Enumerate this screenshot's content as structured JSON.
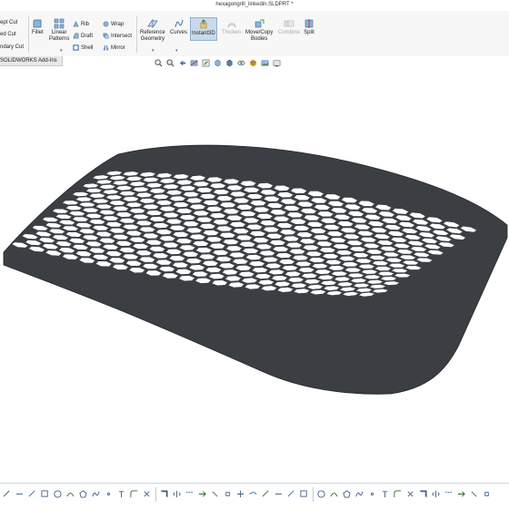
{
  "window": {
    "title": "hexagongrill_linkedin.SLDPRT *"
  },
  "ribbon": {
    "left_items": [
      "ept Cut",
      "ed Cut",
      "ndary Cut"
    ],
    "fillet_label": "Fillet",
    "linear_patterns_label": "Linear\nPatterns",
    "rib_label": "Rib",
    "draft_label": "Draft",
    "shell_label": "Shell",
    "wrap_label": "Wrap",
    "intersect_label": "Intersect",
    "mirror_label": "Mirror",
    "reference_geometry_label": "Reference\nGeometry",
    "curves_label": "Curves",
    "instant3d_label": "Instant3D",
    "thicken_label": "Thicken",
    "move_copy_label": "Move/Copy\nBodies",
    "combine_label": "Combine",
    "split_label": "Split"
  },
  "tabs": {
    "addins_label": "SOLIDWORKS Add-Ins"
  },
  "view_toolbar": {
    "icons": [
      "zoom-to-fit-icon",
      "zoom-area-icon",
      "previous-view-icon",
      "section-view-icon",
      "dynamic-annotation-icon",
      "view-orientation-icon",
      "display-style-icon",
      "hide-show-icon",
      "edit-appearance-icon",
      "apply-scene-icon",
      "view-settings-icon"
    ]
  },
  "bottom_toolbar": {
    "icons": [
      "sketch-icon",
      "smart-dimension-icon",
      "line-icon",
      "rectangle-icon",
      "circle-icon",
      "arc-icon",
      "polygon-icon",
      "spline-icon",
      "point-icon",
      "text-icon",
      "fillet-sketch-icon",
      "trim-icon",
      "offset-icon",
      "mirror-entities-icon",
      "linear-pattern-icon",
      "move-entities-icon",
      "relations-icon",
      "repair-sketch-icon",
      "quick-snaps-icon",
      "rapid-sketch-icon",
      "circle2-icon",
      "slot-icon",
      "ellipse-icon",
      "parabola-icon",
      "construction-line-icon",
      "centerline-icon",
      "tangent-arc-icon",
      "sketch-fillet-icon",
      "chamfer-icon",
      "convert-entities-icon",
      "extend-icon",
      "split-entities-icon",
      "circular-pattern-icon",
      "copy-icon",
      "scale-icon",
      "display-relations-icon",
      "check-sketch-icon",
      "3d-sketch-icon"
    ]
  },
  "colors": {
    "part_body": "#3b3f44",
    "hole_fill": "#ffffff",
    "viewport_bg": "#ffffff",
    "ribbon_bg": "#f7f7f7"
  }
}
